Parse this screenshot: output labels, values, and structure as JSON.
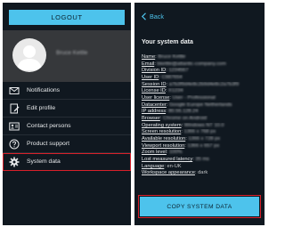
{
  "left": {
    "logout_label": "LOGOUT",
    "profile": {
      "name": "Bruce Kettle"
    },
    "menu": [
      {
        "label": "Notifications",
        "icon": "envelope-icon"
      },
      {
        "label": "Edit profile",
        "icon": "edit-profile-icon"
      },
      {
        "label": "Contact persons",
        "icon": "contact-card-icon"
      },
      {
        "label": "Product support",
        "icon": "help-circle-icon"
      },
      {
        "label": "System data",
        "icon": "gear-icon",
        "active": true
      }
    ]
  },
  "right": {
    "back_label": "Back",
    "title": "Your system data",
    "rows": [
      {
        "key": "Name",
        "value": "Bruce Kettle",
        "obscured": true
      },
      {
        "key": "Email",
        "value": "bkettle@atlantic-company.com",
        "obscured": true
      },
      {
        "key": "Division ID",
        "value": "1234567",
        "obscured": true
      },
      {
        "key": "User ID",
        "value": "C987654",
        "obscured": true
      },
      {
        "key": "Session ID",
        "value": "a7b3f9d4e8c2b9d4e8c2a7b3f9",
        "obscured": true
      },
      {
        "key": "License ID",
        "value": "X1234",
        "obscured": true
      },
      {
        "key": "User license",
        "value": "User - Professional",
        "obscured": true
      },
      {
        "key": "Datacenter",
        "value": "Google Europe Netherlands",
        "obscured": true
      },
      {
        "key": "IP address",
        "value": "80.56.128.24",
        "obscured": true
      },
      {
        "key": "Browser",
        "value": "Chrome on Android",
        "obscured": true
      },
      {
        "key": "Operating system",
        "value": "Windows NT 10.0",
        "obscured": true
      },
      {
        "key": "Screen resolution",
        "value": "1366 x 768 px",
        "obscured": true
      },
      {
        "key": "Available resolution",
        "value": "1366 x 728 px",
        "obscured": true
      },
      {
        "key": "Viewport resolution",
        "value": "1366 x 657 px",
        "obscured": true
      },
      {
        "key": "Zoom level",
        "value": "100%",
        "obscured": true
      },
      {
        "key": "Lost measured latency",
        "value": "35 ms",
        "obscured": true
      },
      {
        "key": "Language",
        "value": "en-UK",
        "obscured": false
      },
      {
        "key": "Workspace appearance",
        "value": "dark",
        "obscured": false
      }
    ],
    "copy_label": "COPY SYSTEM DATA"
  },
  "colors": {
    "accent": "#4dc3ec",
    "panel_bg": "#101820",
    "highlight": "#d8202a",
    "profile_bg": "#36383b"
  }
}
